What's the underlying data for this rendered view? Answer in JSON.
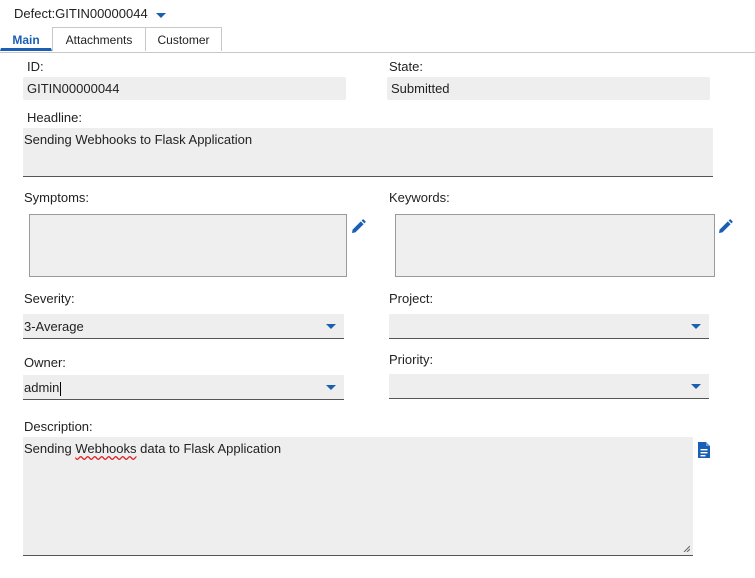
{
  "header": {
    "title": "Defect:GITIN00000044"
  },
  "tabs": [
    {
      "label": "Main",
      "active": true
    },
    {
      "label": "Attachments",
      "active": false
    },
    {
      "label": "Customer",
      "active": false
    }
  ],
  "fields": {
    "id": {
      "label": "ID:",
      "value": "GITIN00000044"
    },
    "state": {
      "label": "State:",
      "value": "Submitted"
    },
    "headline": {
      "label": "Headline:",
      "value": "Sending Webhooks to Flask Application"
    },
    "symptoms": {
      "label": "Symptoms:",
      "value": ""
    },
    "keywords": {
      "label": "Keywords:",
      "value": ""
    },
    "severity": {
      "label": "Severity:",
      "value": "3-Average"
    },
    "project": {
      "label": "Project:",
      "value": ""
    },
    "owner": {
      "label": "Owner:",
      "value": "admin"
    },
    "priority": {
      "label": "Priority:",
      "value": ""
    },
    "description": {
      "label": "Description:",
      "value_before": "Sending ",
      "value_misspelled": "Webhooks",
      "value_after": "  data to Flask Application"
    }
  },
  "colors": {
    "accent": "#1a5fb4",
    "field_bg": "#eeeeee"
  },
  "icons": [
    "chevron-down-icon",
    "pencil-icon",
    "document-icon",
    "resize-grip-icon"
  ]
}
